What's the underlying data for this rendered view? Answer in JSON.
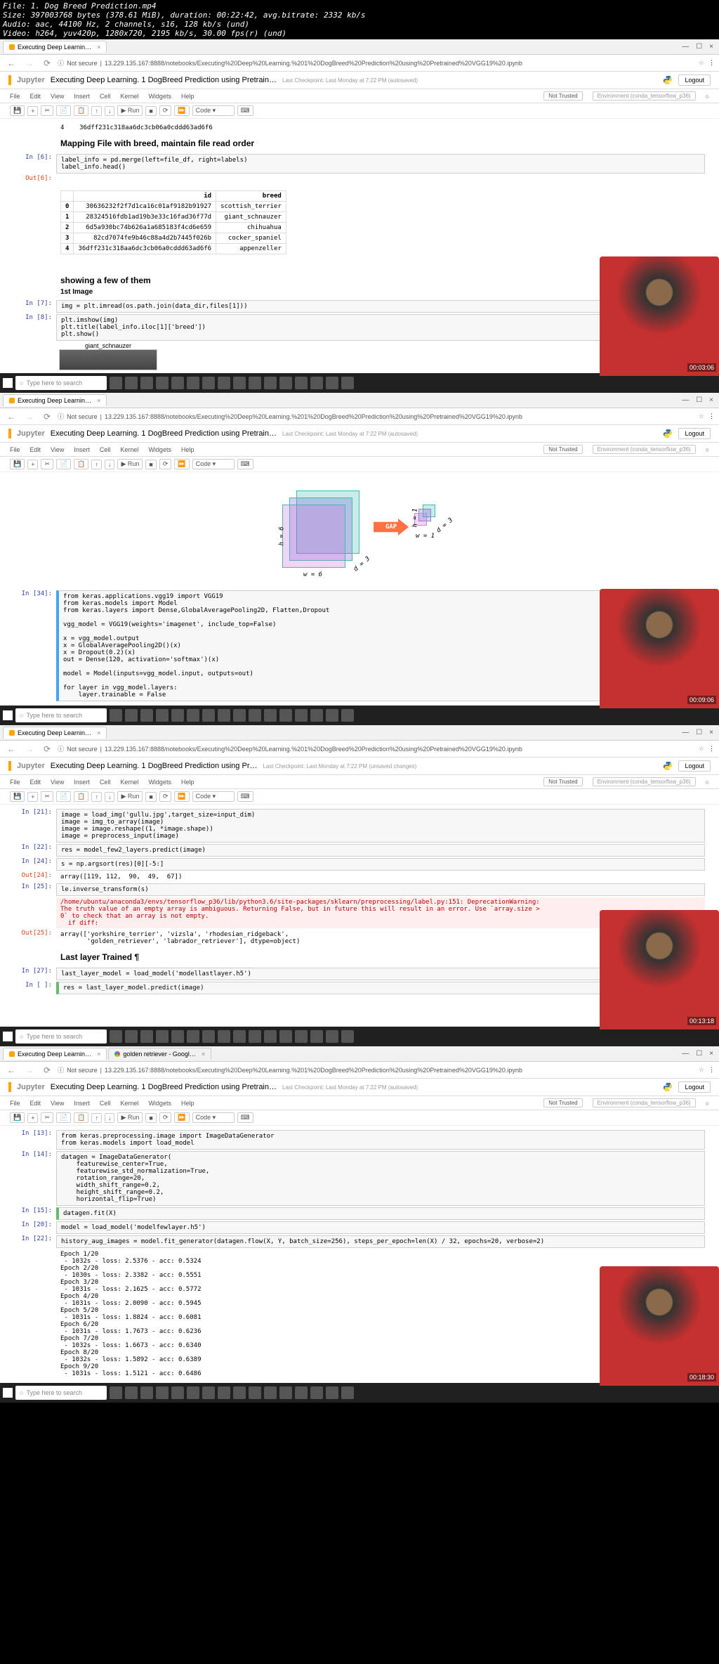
{
  "ffprobe": {
    "line1": "File: 1. Dog Breed Prediction.mp4",
    "line2": "Size: 397003768 bytes (378.61 MiB), duration: 00:22:42, avg.bitrate: 2332 kb/s",
    "line3": "Audio: aac, 44100 Hz, 2 channels, s16, 128 kb/s (und)",
    "line4": "Video: h264, yuv420p, 1280x720, 2195 kb/s, 30.00 fps(r) (und)"
  },
  "common": {
    "tab_title": "Executing Deep Learnin…",
    "tab_google": "golden retriever - Googl…",
    "url": "13.229.135.167:8888/notebooks/Executing%20Deep%20Learning.%201%20DogBreed%20Prediction%20using%20Pretrained%20VGG19%20.ipynb",
    "not_secure": "Not secure",
    "jupyter": "Jupyter",
    "title_full": "Executing Deep Learning. 1 DogBreed Prediction using Pretrain…",
    "title_short": "Executing Deep Learning. 1 DogBreed Prediction using Pr…",
    "checkpoint": "Last Checkpoint: Last Monday at 7:22 PM",
    "autosaved": "(autosaved)",
    "unsaved": "(unsaved changes)",
    "logout": "Logout",
    "not_trusted": "Not Trusted",
    "env": "Environment (conda_tensorflow_p36)",
    "menu": {
      "file": "File",
      "edit": "Edit",
      "view": "View",
      "insert": "Insert",
      "cell": "Cell",
      "kernel": "Kernel",
      "widgets": "Widgets",
      "help": "Help"
    },
    "toolbar": {
      "run": "Run",
      "code": "Code"
    },
    "search_placeholder": "Type here to search"
  },
  "p1": {
    "row4": "4    36dff231c318aa6dc3cb06a0cddd63ad6f6",
    "md_heading": "Mapping File with breed, maintain file read order",
    "in6_prompt": "In [6]:",
    "in6_code": "label_info = pd.merge(left=file_df, right=labels)\nlabel_info.head()",
    "out6_prompt": "Out[6]:",
    "table": {
      "cols": [
        "",
        "id",
        "breed"
      ],
      "rows": [
        [
          "0",
          "30636232f2f7d1ca16c01af9182b91927",
          "scottish_terrier"
        ],
        [
          "1",
          "28324516fdb1ad19b3e33c16fad36f77d",
          "giant_schnauzer"
        ],
        [
          "2",
          "6d5a930bc74b626a1a685183f4cd6e659",
          "chihuahua"
        ],
        [
          "3",
          "82cd7074fe9b46c88a4d2b7445f026b",
          "cocker_spaniel"
        ],
        [
          "4",
          "36dff231c318aa6dc3cb06a0cddd63ad6f6",
          "appenzeller"
        ]
      ]
    },
    "md_showing": "showing a few of them",
    "md_first": "1st Image",
    "in7_prompt": "In [7]:",
    "in7_code": "img = plt.imread(os.path.join(data_dir,files[1]))",
    "in8_prompt": "In [8]:",
    "in8_code": "plt.imshow(img)\nplt.title(label_info.iloc[1]['breed'])\nplt.show()",
    "plot_title": "giant_schnauzer",
    "timestamp": "00:03:06"
  },
  "p2": {
    "gap_label": "GAP",
    "w_label": "w = 6",
    "h_label": "h = 6",
    "d_label": "d = 3",
    "w1": "w = 1",
    "h1": "h = 1",
    "d1": "d = 3",
    "in34_prompt": "In [34]:",
    "in34_code": "from keras.applications.vgg19 import VGG19\nfrom keras.models import Model\nfrom keras.layers import Dense,GlobalAveragePooling2D, Flatten,Dropout\n\nvgg_model = VGG19(weights='imagenet', include_top=False)\n\nx = vgg_model.output\nx = GlobalAveragePooling2D()(x)\nx = Dropout(0.2)(x)\nout = Dense(120, activation='softmax')(x)\n\nmodel = Model(inputs=vgg_model.input, outputs=out)\n\nfor layer in vgg_model.layers:\n    layer.trainable = False",
    "timestamp": "00:09:06"
  },
  "p3": {
    "in21_prompt": "In [21]:",
    "in21_code": "image = load_img('gullu.jpg',target_size=input_dim)\nimage = img_to_array(image)\nimage = image.reshape((1, *image.shape))\nimage = preprocess_input(image)",
    "in22_prompt": "In [22]:",
    "in22_code": "res = model_few2_layers.predict(image)",
    "in24_prompt": "In [24]:",
    "in24_code": "s = np.argsort(res)[0][-5:]",
    "out24_prompt": "Out[24]:",
    "out24_val": "array([119, 112,  90,  49,  67])",
    "in25_prompt": "In [25]:",
    "in25_code": "le.inverse_transform(s)",
    "warn": "/home/ubuntu/anaconda3/envs/tensorflow_p36/lib/python3.6/site-packages/sklearn/preprocessing/label.py:151: DeprecationWarning:\nThe truth value of an empty array is ambiguous. Returning False, but in future this will result in an error. Use `array.size >\n0` to check that an array is not empty.\n  if diff:",
    "out25_prompt": "Out[25]:",
    "out25_val": "array(['yorkshire_terrier', 'vizsla', 'rhodesian_ridgeback',\n       'golden_retriever', 'labrador_retriever'], dtype=object)",
    "md_last": "Last layer Trained    ¶",
    "in27_prompt": "In [27]:",
    "in27_code": "last_layer_model = load_model('modellastlayer.h5')",
    "in_blank_prompt": "In [ ]:",
    "in_blank_code": "res = last_layer_model.predict(image)",
    "timestamp": "00:13:18"
  },
  "p4": {
    "in13_prompt": "In [13]:",
    "in13_code": "from keras.preprocessing.image import ImageDataGenerator\nfrom keras.models import load_model",
    "in14_prompt": "In [14]:",
    "in14_code": "datagen = ImageDataGenerator(\n    featurewise_center=True,\n    featurewise_std_normalization=True,\n    rotation_range=20,\n    width_shift_range=0.2,\n    height_shift_range=0.2,\n    horizontal_flip=True)",
    "in15_prompt": "In [15]:",
    "in15_code": "datagen.fit(X)",
    "in20_prompt": "In [20]:",
    "in20_code": "model = load_model('modelfewlayer.h5')",
    "in22_prompt": "In [22]:",
    "in22_code": "history_aug_images = model.fit_generator(datagen.flow(X, Y, batch_size=256), steps_per_epoch=len(X) / 32, epochs=20, verbose=2)",
    "out22": "Epoch 1/20\n - 1032s - loss: 2.5376 - acc: 0.5324\nEpoch 2/20\n - 1030s - loss: 2.3382 - acc: 0.5551\nEpoch 3/20\n - 1031s - loss: 2.1625 - acc: 0.5772\nEpoch 4/20\n - 1031s - loss: 2.0090 - acc: 0.5945\nEpoch 5/20\n - 1031s - loss: 1.8824 - acc: 0.6081\nEpoch 6/20\n - 1031s - loss: 1.7673 - acc: 0.6236\nEpoch 7/20\n - 1032s - loss: 1.6673 - acc: 0.6340\nEpoch 8/20\n - 1032s - loss: 1.5892 - acc: 0.6389\nEpoch 9/20\n - 1031s - loss: 1.5121 - acc: 0.6486",
    "timestamp": "00:18:30"
  }
}
